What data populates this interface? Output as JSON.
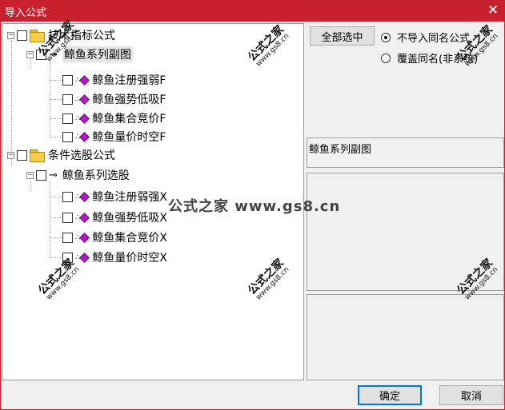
{
  "window": {
    "title": "导入公式",
    "close_glyph": "✕"
  },
  "tree": {
    "groups": [
      {
        "label": "技术指标公式",
        "expander": "−",
        "child": {
          "label": "鲸鱼系列副图",
          "expander": "−",
          "items": [
            "鲸鱼注册强弱F",
            "鲸鱼强势低吸F",
            "鲸鱼集合竞价F",
            "鲸鱼量价时空F"
          ]
        }
      },
      {
        "label": "条件选股公式",
        "expander": "−",
        "child": {
          "label": "鲸鱼系列选股",
          "expander": "−",
          "items": [
            "鲸鱼注册弱强X",
            "鲸鱼强势低吸X",
            "鲸鱼集合竞价X",
            "鲸鱼量价时空X"
          ]
        }
      }
    ]
  },
  "controls": {
    "select_all": "全部选中",
    "radio_skip": "不导入同名公式",
    "radio_overwrite": "覆盖同名(非系统)",
    "selected_name": "鲸鱼系列副图"
  },
  "footer": {
    "ok": "确定",
    "cancel": "取消"
  },
  "watermark": {
    "brand": "公式之家",
    "url": "www.gs8.cn",
    "center": "公式之家 www.gs8.cn"
  },
  "colors": {
    "titlebar": "#c8202d",
    "gem": "#b319c9",
    "folder": "#f5cf4a"
  }
}
